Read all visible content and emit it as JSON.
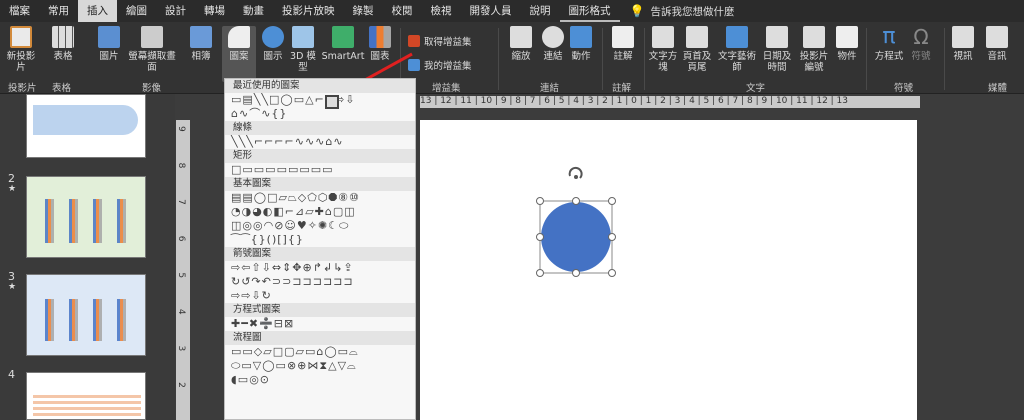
{
  "tabs": [
    "檔案",
    "常用",
    "插入",
    "繪圖",
    "設計",
    "轉場",
    "動畫",
    "投影片放映",
    "錄製",
    "校閱",
    "檢視",
    "開發人員",
    "說明",
    "圖形格式"
  ],
  "tell_me": "告訴我您想做什麼",
  "ribbon": {
    "new_slide": "新投影片",
    "table": "表格",
    "picture": "圖片",
    "screenshot": "螢幕擷取畫面",
    "album": "相簿",
    "shapes": "圖案",
    "icons": "圖示",
    "model3d": "3D 模型",
    "smartart": "SmartArt",
    "chart": "圖表",
    "get_addins": "取得增益集",
    "my_addins": "我的增益集",
    "zoom": "縮放",
    "link": "連結",
    "action": "動作",
    "comment": "註解",
    "textbox": "文字方塊",
    "header_footer": "頁首及頁尾",
    "wordart": "文字藝術師",
    "datetime": "日期及時間",
    "slide_number": "投影片編號",
    "object": "物件",
    "equation": "方程式",
    "symbol": "符號",
    "video": "視訊",
    "audio": "音訊",
    "groups": {
      "slides": "投影片",
      "tables": "表格",
      "images": "影像",
      "addins": "增益集",
      "links": "連結",
      "comments": "註解",
      "text": "文字",
      "symbols": "符號",
      "media": "媒體"
    }
  },
  "slides": [
    {
      "num": "2",
      "star": "★"
    },
    {
      "num": "3",
      "star": "★"
    },
    {
      "num": "4"
    }
  ],
  "menu": {
    "recent": "最近使用的圖案",
    "lines": "線條",
    "rect": "矩形",
    "basic": "基本圖案",
    "arrows": "箭號圖案",
    "equation": "方程式圖案",
    "flowchart": "流程圖",
    "rows": {
      "recent1": "▭▤╲╲□◯▭△⌐⌐⇨⇩",
      "recent2": "⌂∿⌒∿{}",
      "lines": "╲╲╲⌐⌐⌐⌐∿∿∿⌂∿",
      "rect": "□▭▭▭▭▭▭▭▭",
      "basic1": "▤▤◯□▱⏢◇⬠⬡⯃⑧⑩",
      "basic2": "◔◑◕◐◧⌐⊿▱✚⌂▢◫",
      "basic3": "◫◎◎◠⊘☺♥✧✺☾⬭",
      "basic4": "⁀⁀{}()[]{}",
      "arrows1": "⇨⇦⇧⇩⇔⇕✥⊕↱↲↳⇪",
      "arrows2": "↻↺↷↶⊃⊃⊐⊐⊐⊐⊐⊐",
      "arrows3": "⇨⇨⇩↻",
      "equation1": "✚━✖➗⊟⊠",
      "flow1": "▭▭◇▱□▢▱▭⌂◯▭⌓",
      "flow2": "⬭▭▽◯▭⊗⊕⋈⧗△▽⌓",
      "flow3": "◖▭◎⊙"
    }
  },
  "ruler_labels": "13 | 12 | 11 | 10 | 9 | 8 | 7 | 6 | 5 | 4 | 3 | 2 | 1 | 0 | 1 | 2 | 3 | 4 | 5 | 6 | 7 | 8 | 9 | 10 | 11 | 12 | 13",
  "vruler_labels": "9 8 7 6 5 4 3 2",
  "colors": {
    "circle": "#4472c4",
    "arrow": "#e02020"
  }
}
